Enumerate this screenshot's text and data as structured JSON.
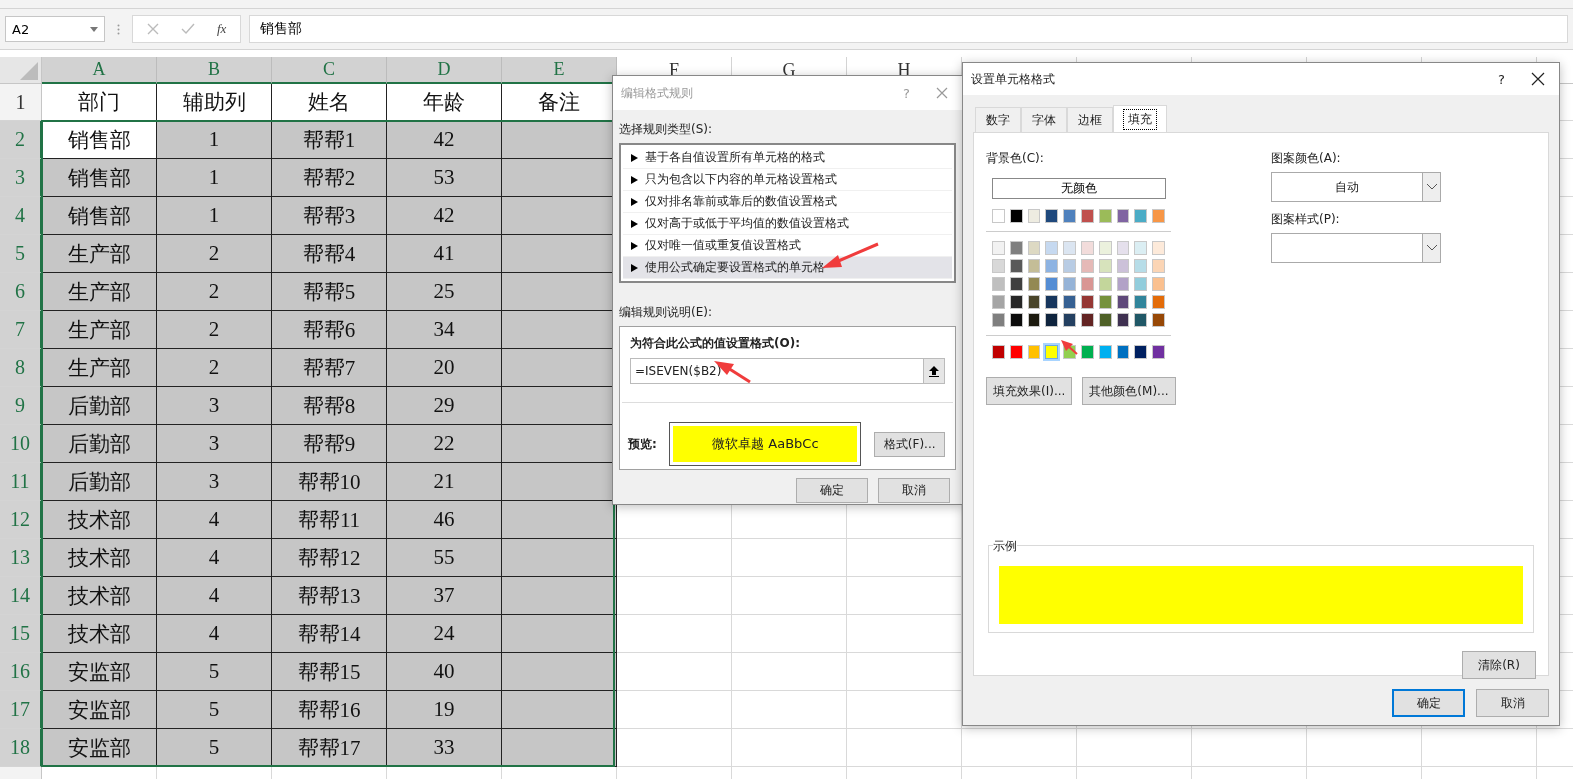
{
  "formula_bar": {
    "name_box": "A2",
    "function_label": "fx",
    "formula": "销售部"
  },
  "sheet": {
    "columns": [
      {
        "label": "A",
        "selected": true
      },
      {
        "label": "B",
        "selected": true
      },
      {
        "label": "C",
        "selected": true
      },
      {
        "label": "D",
        "selected": true
      },
      {
        "label": "E",
        "selected": true
      },
      {
        "label": "F",
        "selected": false
      },
      {
        "label": "G",
        "selected": false
      },
      {
        "label": "H",
        "selected": false
      }
    ],
    "rows": [
      {
        "number": "1",
        "selected": false,
        "cells": [
          "部门",
          "辅助列",
          "姓名",
          "年龄",
          "备注"
        ]
      },
      {
        "number": "2",
        "selected": true,
        "active": true,
        "cells": [
          "销售部",
          "1",
          "帮帮1",
          "42"
        ]
      },
      {
        "number": "3",
        "selected": true,
        "cells": [
          "销售部",
          "1",
          "帮帮2",
          "53"
        ]
      },
      {
        "number": "4",
        "selected": true,
        "cells": [
          "销售部",
          "1",
          "帮帮3",
          "42"
        ]
      },
      {
        "number": "5",
        "selected": true,
        "cells": [
          "生产部",
          "2",
          "帮帮4",
          "41"
        ]
      },
      {
        "number": "6",
        "selected": true,
        "cells": [
          "生产部",
          "2",
          "帮帮5",
          "25"
        ]
      },
      {
        "number": "7",
        "selected": true,
        "cells": [
          "生产部",
          "2",
          "帮帮6",
          "34"
        ]
      },
      {
        "number": "8",
        "selected": true,
        "cells": [
          "生产部",
          "2",
          "帮帮7",
          "20"
        ]
      },
      {
        "number": "9",
        "selected": true,
        "cells": [
          "后勤部",
          "3",
          "帮帮8",
          "29"
        ]
      },
      {
        "number": "10",
        "selected": true,
        "cells": [
          "后勤部",
          "3",
          "帮帮9",
          "22"
        ]
      },
      {
        "number": "11",
        "selected": true,
        "cells": [
          "后勤部",
          "3",
          "帮帮10",
          "21"
        ]
      },
      {
        "number": "12",
        "selected": true,
        "cells": [
          "技术部",
          "4",
          "帮帮11",
          "46"
        ]
      },
      {
        "number": "13",
        "selected": true,
        "cells": [
          "技术部",
          "4",
          "帮帮12",
          "55"
        ]
      },
      {
        "number": "14",
        "selected": true,
        "cells": [
          "技术部",
          "4",
          "帮帮13",
          "37"
        ]
      },
      {
        "number": "15",
        "selected": true,
        "cells": [
          "技术部",
          "4",
          "帮帮14",
          "24"
        ]
      },
      {
        "number": "16",
        "selected": true,
        "cells": [
          "安监部",
          "5",
          "帮帮15",
          "40"
        ]
      },
      {
        "number": "17",
        "selected": true,
        "cells": [
          "安监部",
          "5",
          "帮帮16",
          "19"
        ]
      },
      {
        "number": "18",
        "selected": true,
        "cells": [
          "安监部",
          "5",
          "帮帮17",
          "33"
        ]
      }
    ]
  },
  "rule_dialog": {
    "title": "编辑格式规则",
    "active": false,
    "help": "?",
    "rule_type_label": "选择规则类型(S):",
    "rule_types": [
      {
        "label": "基于各自值设置所有单元格的格式",
        "selected": false
      },
      {
        "label": "只为包含以下内容的单元格设置格式",
        "selected": false
      },
      {
        "label": "仅对排名靠前或靠后的数值设置格式",
        "selected": false
      },
      {
        "label": "仅对高于或低于平均值的数值设置格式",
        "selected": false
      },
      {
        "label": "仅对唯一值或重复值设置格式",
        "selected": false
      },
      {
        "label": "使用公式确定要设置格式的单元格",
        "selected": true
      }
    ],
    "description_label": "编辑规则说明(E):",
    "formula_label": "为符合此公式的值设置格式(O):",
    "formula": "=ISEVEN($B2)",
    "preview_label": "预览:",
    "preview_text": "微软卓越  AaBbCc",
    "format_button": "格式(F)...",
    "buttons": [
      "确定",
      "取消"
    ]
  },
  "format_dialog": {
    "title": "设置单元格格式",
    "active": true,
    "help": "?",
    "tabs": [
      {
        "label": "数字",
        "selected": false
      },
      {
        "label": "字体",
        "selected": false
      },
      {
        "label": "边框",
        "selected": false
      },
      {
        "label": "填充",
        "selected": true
      }
    ],
    "background_label": "背景色(C):",
    "no_color_button": "无颜色",
    "theme_colors": [
      {
        "color": "#ffffff",
        "selected": false
      },
      {
        "color": "#000000",
        "selected": false
      },
      {
        "color": "#eeece1",
        "selected": false
      },
      {
        "color": "#1f497d",
        "selected": false
      },
      {
        "color": "#4f81bd",
        "selected": false
      },
      {
        "color": "#c0504d",
        "selected": false
      },
      {
        "color": "#9bbb59",
        "selected": false
      },
      {
        "color": "#8064a2",
        "selected": false
      },
      {
        "color": "#4bacc6",
        "selected": false
      },
      {
        "color": "#f79646",
        "selected": false
      }
    ],
    "shades": [
      [
        {
          "color": "#f2f2f2",
          "selected": false
        },
        {
          "color": "#7f7f7f",
          "selected": false
        },
        {
          "color": "#ddd9c3",
          "selected": false
        },
        {
          "color": "#c6d9f0",
          "selected": false
        },
        {
          "color": "#dbe5f1",
          "selected": false
        },
        {
          "color": "#f2dcdb",
          "selected": false
        },
        {
          "color": "#ebf1dd",
          "selected": false
        },
        {
          "color": "#e5e0ec",
          "selected": false
        },
        {
          "color": "#dbeef3",
          "selected": false
        },
        {
          "color": "#fdeada",
          "selected": false
        }
      ],
      [
        {
          "color": "#d8d8d8",
          "selected": false
        },
        {
          "color": "#595959",
          "selected": false
        },
        {
          "color": "#c4bd97",
          "selected": false
        },
        {
          "color": "#8db3e2",
          "selected": false
        },
        {
          "color": "#b8cce4",
          "selected": false
        },
        {
          "color": "#e5b9b7",
          "selected": false
        },
        {
          "color": "#d7e3bc",
          "selected": false
        },
        {
          "color": "#ccc1d9",
          "selected": false
        },
        {
          "color": "#b7dde8",
          "selected": false
        },
        {
          "color": "#fbd5b5",
          "selected": false
        }
      ],
      [
        {
          "color": "#bfbfbf",
          "selected": false
        },
        {
          "color": "#3f3f3f",
          "selected": false
        },
        {
          "color": "#938953",
          "selected": false
        },
        {
          "color": "#548dd4",
          "selected": false
        },
        {
          "color": "#95b3d7",
          "selected": false
        },
        {
          "color": "#d99694",
          "selected": false
        },
        {
          "color": "#c3d69b",
          "selected": false
        },
        {
          "color": "#b2a2c7",
          "selected": false
        },
        {
          "color": "#92cddc",
          "selected": false
        },
        {
          "color": "#fac08f",
          "selected": false
        }
      ],
      [
        {
          "color": "#a5a5a5",
          "selected": false
        },
        {
          "color": "#262626",
          "selected": false
        },
        {
          "color": "#494429",
          "selected": false
        },
        {
          "color": "#17365d",
          "selected": false
        },
        {
          "color": "#366092",
          "selected": false
        },
        {
          "color": "#953734",
          "selected": false
        },
        {
          "color": "#76923c",
          "selected": false
        },
        {
          "color": "#5f497a",
          "selected": false
        },
        {
          "color": "#31859b",
          "selected": false
        },
        {
          "color": "#e36c09",
          "selected": false
        }
      ],
      [
        {
          "color": "#7f7f7f",
          "selected": false
        },
        {
          "color": "#0c0c0c",
          "selected": false
        },
        {
          "color": "#1d1b10",
          "selected": false
        },
        {
          "color": "#0f243e",
          "selected": false
        },
        {
          "color": "#244061",
          "selected": false
        },
        {
          "color": "#632423",
          "selected": false
        },
        {
          "color": "#4f6128",
          "selected": false
        },
        {
          "color": "#3f3151",
          "selected": false
        },
        {
          "color": "#205867",
          "selected": false
        },
        {
          "color": "#974806",
          "selected": false
        }
      ]
    ],
    "standard_colors": [
      {
        "color": "#c00000",
        "selected": false
      },
      {
        "color": "#ff0000",
        "selected": false
      },
      {
        "color": "#ffc000",
        "selected": false
      },
      {
        "color": "#ffff00",
        "selected": true
      },
      {
        "color": "#92d050",
        "selected": false
      },
      {
        "color": "#00b050",
        "selected": false
      },
      {
        "color": "#00b0f0",
        "selected": false
      },
      {
        "color": "#0070c0",
        "selected": false
      },
      {
        "color": "#002060",
        "selected": false
      },
      {
        "color": "#7030a0",
        "selected": false
      }
    ],
    "effect_buttons": [
      "填充效果(I)...",
      "其他颜色(M)..."
    ],
    "pattern_color_label": "图案颜色(A):",
    "pattern_color": "自动",
    "pattern_style_label": "图案样式(P):",
    "sample_label": "示例",
    "clear_button": "清除(R)",
    "buttons": [
      {
        "label": "确定",
        "default": true
      },
      {
        "label": "取消",
        "default": false
      }
    ]
  }
}
